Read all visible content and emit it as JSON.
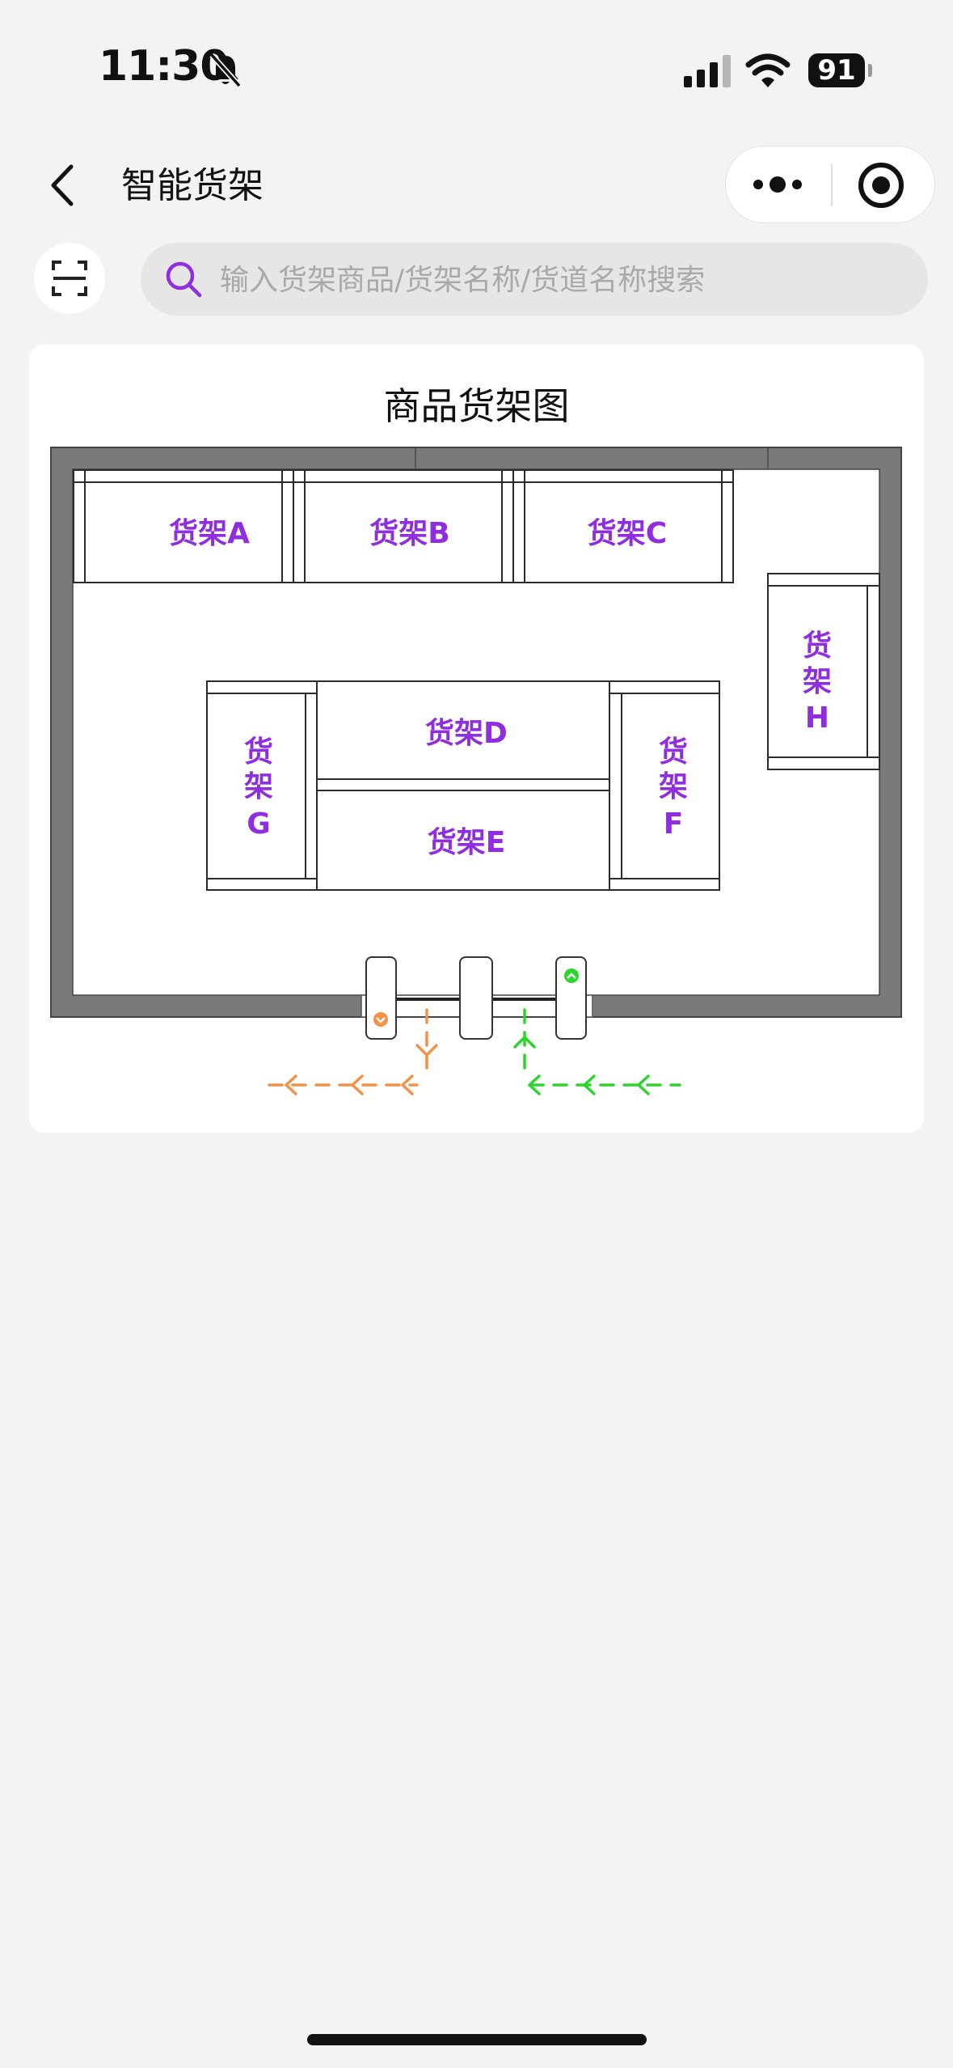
{
  "status_bar": {
    "time": "11:30",
    "battery": "91"
  },
  "nav": {
    "title": "智能货架"
  },
  "search": {
    "placeholder": "输入货架商品/货架名称/货道名称搜索"
  },
  "map": {
    "title": "商品货架图",
    "shelves": {
      "A": "货架A",
      "B": "货架B",
      "C": "货架C",
      "D": "货架D",
      "E": "货架E",
      "F_lines": [
        "货",
        "架",
        "F"
      ],
      "G_lines": [
        "货",
        "架",
        "G"
      ],
      "H_lines": [
        "货",
        "架",
        "H"
      ]
    }
  },
  "colors": {
    "shelf_label": "#8e2ee0",
    "wall": "#7a7a7a",
    "exit_arrow": "#f39147",
    "entry_arrow": "#2bd52b"
  }
}
